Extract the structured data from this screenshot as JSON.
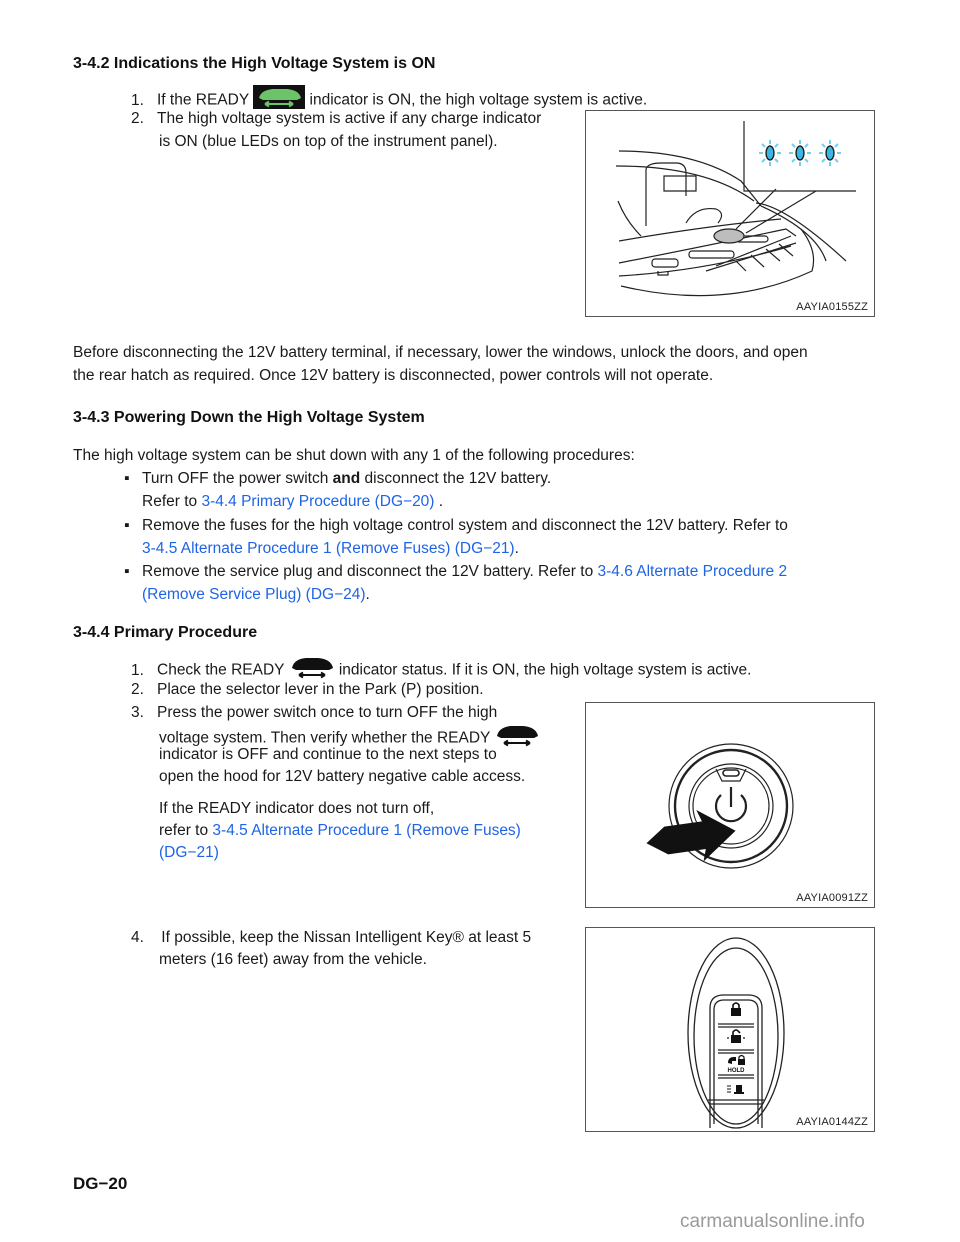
{
  "section_342": {
    "heading": "3-4.2  Indications the High Voltage System is ON",
    "item1_num": "1.",
    "item1_pre": "If the READY",
    "item1_post": "indicator is ON, the high voltage system is active.",
    "item2_num": "2.",
    "item2_line1": "The high voltage system is active if any charge indicator",
    "item2_line2": "is ON (blue LEDs on top of the instrument panel).",
    "figure_code": "AAYIA0155ZZ",
    "ready_icon": "ready-car-icon-green"
  },
  "note": {
    "line1": "Before disconnecting the 12V battery terminal, if necessary, lower the windows, unlock the doors, and open",
    "line2": "the rear hatch as required. Once 12V battery is disconnected, power controls will not operate."
  },
  "section_343": {
    "heading": "3-4.3  Powering Down the High Voltage System",
    "intro": "The high voltage system can be shut down with any 1 of the following procedures:",
    "bullet_glyph": "▪",
    "bullet1_pre": "Turn OFF the power switch ",
    "bullet1_bold": "and",
    "bullet1_post": " disconnect the 12V battery.",
    "bullet1_refer": "Refer to ",
    "bullet1_link": "3-4.4   Primary Procedure (DG−20)",
    "bullet1_end": " .",
    "bullet2_line1": "Remove the fuses for the high voltage control system and disconnect the 12V battery. Refer to",
    "bullet2_link": "3-4.5  Alternate Procedure 1 (Remove Fuses) (DG−21)",
    "bullet2_end": ".",
    "bullet3_pre": "Remove the service plug and disconnect the 12V battery. Refer to ",
    "bullet3_link1": "3-4.6  Alternate Procedure 2",
    "bullet3_link2": "(Remove Service Plug) (DG−24)",
    "bullet3_end": "."
  },
  "section_344": {
    "heading": "3-4.4   Primary Procedure",
    "step1_num": "1.",
    "step1_pre": "Check the READY",
    "step1_post": "indicator status. If it is ON, the high voltage system is active.",
    "step2_num": "2.",
    "step2": "Place the selector lever in the Park (P) position.",
    "step3_num": "3.",
    "step3_line1": "Press the power switch once to turn OFF the high",
    "step3_line2": "voltage system. Then verify whether the READY",
    "step3_line3": "indicator is OFF and continue to the next steps to",
    "step3_line4": "open the hood for 12V battery negative cable access.",
    "step3_note1": "If the READY indicator does not turn off,",
    "step3_note2_pre": "refer to ",
    "step3_note2_link": "3-4.5  Alternate Procedure 1 (Remove Fuses)",
    "step3_note3_link": "(DG−21)",
    "figure2_code": "AAYIA0091ZZ",
    "step4_num": "4.",
    "step4_line1": " If possible, keep the Nissan Intelligent Key® at least 5",
    "step4_line2": "meters (16 feet) away from the vehicle.",
    "figure3_code": "AAYIA0144ZZ",
    "key_hold_label": "HOLD"
  },
  "footer": {
    "page_id": "DG−20",
    "watermark": "carmanualsonline.info"
  },
  "colors": {
    "link": "#1e64e6",
    "ready_green": "#5cb85c",
    "led_blue": "#4cc6ea"
  }
}
